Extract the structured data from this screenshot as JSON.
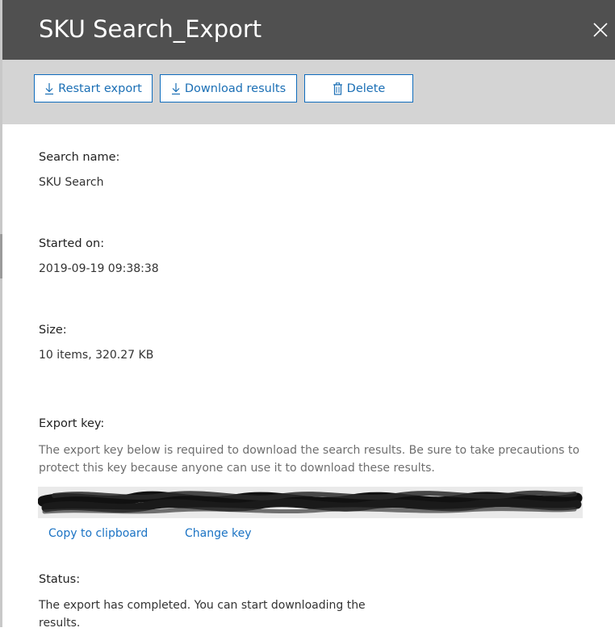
{
  "panel": {
    "title": "SKU Search_Export"
  },
  "toolbar": {
    "restart_label": "Restart export",
    "download_label": "Download results",
    "delete_label": "Delete"
  },
  "details": {
    "search_name_label": "Search name:",
    "search_name_value": "SKU Search",
    "started_on_label": "Started on:",
    "started_on_value": "2019-09-19 09:38:38",
    "size_label": "Size:",
    "size_value": "10 items, 320.27 KB",
    "export_key_label": "Export key:",
    "export_key_description": "The export key below is required to download the search results. Be sure to take precautions to protect this key because anyone can use it to download these results.",
    "copy_link": "Copy to clipboard",
    "change_key_link": "Change key",
    "status_label": "Status:",
    "status_value": "The export has completed. You can start downloading the results."
  },
  "colors": {
    "header_bg": "#505050",
    "toolbar_bg": "#d4d4d4",
    "accent": "#1b6fb5"
  },
  "icons": {
    "close": "close-icon",
    "restart": "download-arrow-icon",
    "download": "download-arrow-icon",
    "delete": "trash-icon"
  }
}
